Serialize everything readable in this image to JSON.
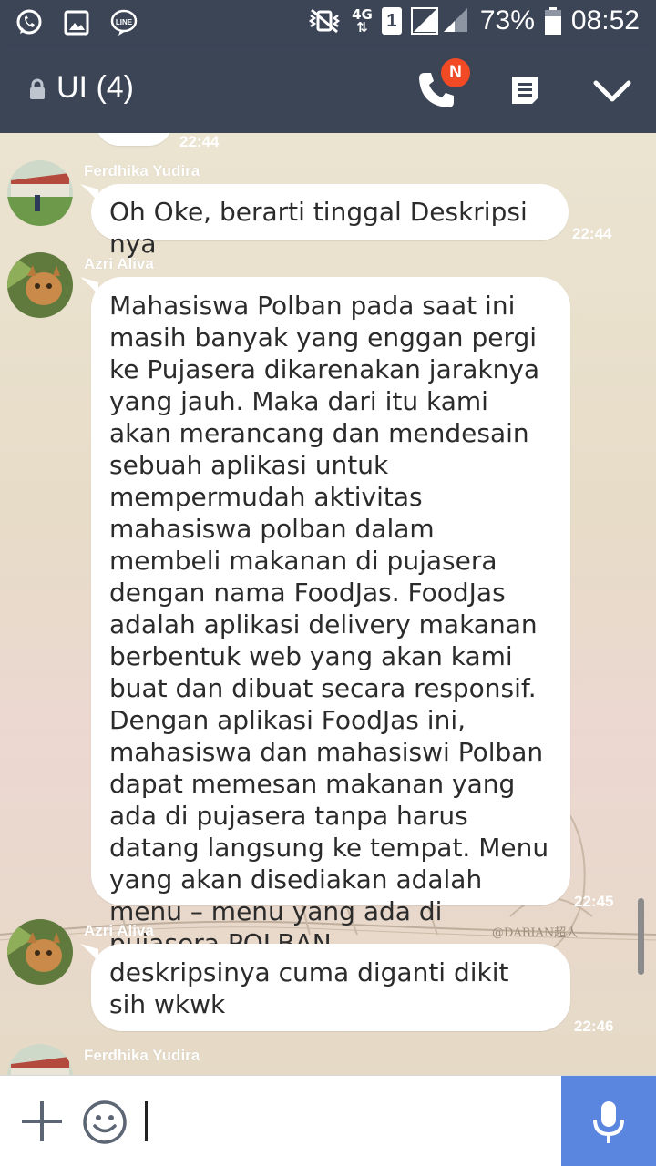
{
  "status_bar": {
    "network": "4G",
    "sim": "1",
    "battery": "73%",
    "clock": "08:52",
    "icons": [
      "whatsapp-icon",
      "gallery-icon",
      "line-icon",
      "mute-vibrate-icon",
      "signal-icon",
      "battery-icon"
    ]
  },
  "header": {
    "title": "UI (4)",
    "badge": "N",
    "icons": [
      "lock-icon",
      "call-icon",
      "notes-icon",
      "chevron-down-icon"
    ]
  },
  "messages": [
    {
      "sender": "",
      "text": "",
      "time": "22:44"
    },
    {
      "sender": "Ferdhika Yudira",
      "text": "Oh Oke, berarti tinggal Deskripsi nya",
      "time": "22:44"
    },
    {
      "sender": "Azri Aliva",
      "text": "Mahasiswa Polban pada saat ini masih banyak yang enggan pergi ke Pujasera dikarenakan jaraknya yang jauh. Maka dari itu kami akan merancang dan mendesain sebuah aplikasi untuk mempermudah aktivitas mahasiswa polban dalam membeli makanan di pujasera dengan nama FoodJas. FoodJas adalah aplikasi delivery makanan berbentuk web yang akan kami buat dan dibuat secara responsif. Dengan aplikasi FoodJas ini, mahasiswa dan mahasiswi Polban dapat memesan makanan yang ada di pujasera tanpa harus datang langsung ke tempat. Menu yang akan disediakan adalah menu – menu yang ada di pujasera POLBAN.",
      "time": "22:45"
    },
    {
      "sender": "Azri Aliva",
      "text": "deskripsinya cuma diganti dikit sih wkwk",
      "time": "22:46"
    },
    {
      "sender": "Ferdhika Yudira",
      "text": "",
      "time": ""
    }
  ],
  "watermark": "@DABIAN超人",
  "input": {
    "value": "",
    "icons": [
      "plus-icon",
      "emoji-icon",
      "microphone-icon"
    ]
  },
  "colors": {
    "header_bg": "#3b4556",
    "accent_blue": "#5a86e0",
    "badge_red": "#f24a25",
    "bubble": "#ffffff"
  }
}
